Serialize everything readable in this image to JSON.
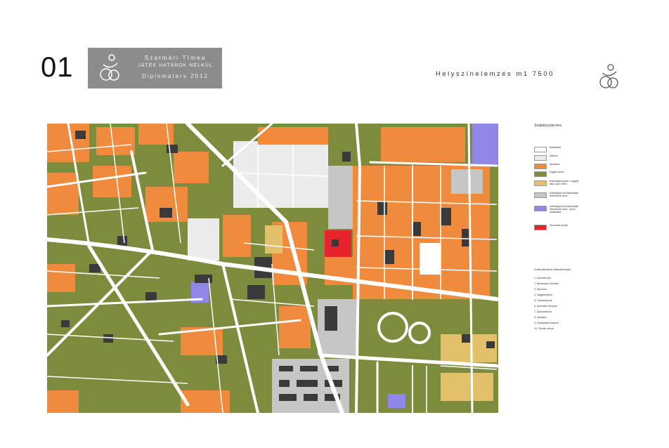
{
  "sheet": {
    "number": "01"
  },
  "title_box": {
    "line1": "Szatmári Tímea",
    "line2": "JÁTÉK HATÁROK NÉLKÜL",
    "line3": "Diplomaterv 2012"
  },
  "heading": "Helyszínelemzés  m1 7500",
  "colors": {
    "title_box": "#8c8c8c",
    "residential": "#f08a3c",
    "green": "#7d8c3c",
    "public": "#ececec",
    "industrial": "#c6c6c6",
    "sport": "#8f86e6",
    "site": "#e8232b",
    "building": "#3a3a3a",
    "yellow": "#e3c06a",
    "road": "#ffffff"
  },
  "legend": {
    "title": "Szabályozási terv",
    "items": [
      {
        "label": "Közterület",
        "color": "#ffffff"
      },
      {
        "label": "Úttorzó",
        "color": "#ececec"
      },
      {
        "label": "lakózóna",
        "color": "#f08a3c"
      },
      {
        "label": "vegyes zóna",
        "color": "#7d8c3c"
      },
      {
        "label": "településközpont - vegyes lakó- ipari zóna",
        "color": "#e3c06a"
      },
      {
        "label": "különleges közhasználatú rekreációs zóna",
        "color": "#c6c6c6"
      },
      {
        "label": "különleges közhasználatú rekreációs zóna - sport, szabadidő",
        "color": "#8f86e6"
      },
      {
        "label": "Tervezési terület",
        "color": "#e8232b"
      }
    ]
  },
  "list": {
    "title": "Kulturális/sport létesítmények",
    "items": [
      "1. Kossuth kert",
      "2. Bessenyei Színház",
      "3. Múzeum",
      "4. Nagytemplom",
      "5. Tornacsarnok",
      "6. Kulturális Központ",
      "7. Sportcsarnok",
      "8. Vásártér",
      "9. Szabadidő-központ",
      "10. Óvoda, iskola"
    ]
  },
  "map": {
    "name": "Helyszínelemzés térkép"
  }
}
